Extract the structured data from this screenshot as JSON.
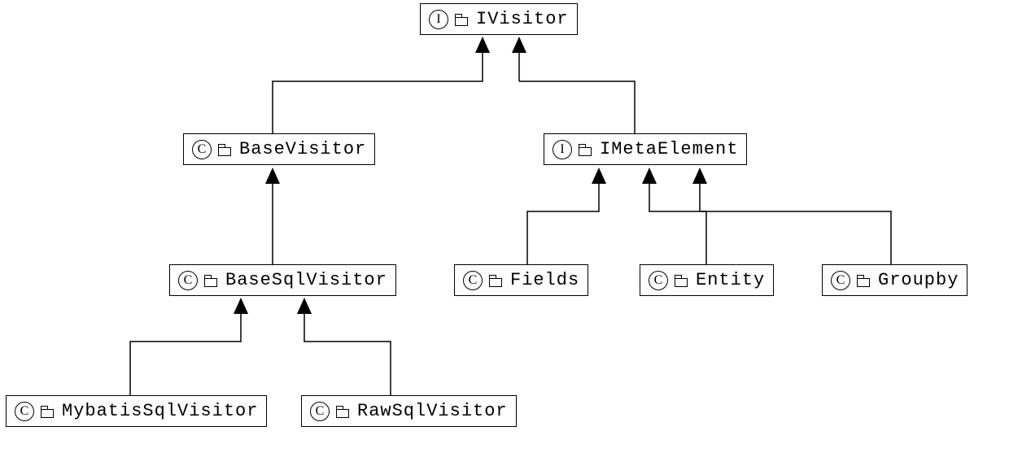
{
  "nodes": {
    "ivisitor": {
      "label": "IVisitor",
      "stereotype": "I"
    },
    "basevisitor": {
      "label": "BaseVisitor",
      "stereotype": "C"
    },
    "imetaelement": {
      "label": "IMetaElement",
      "stereotype": "I"
    },
    "basesqlvisitor": {
      "label": "BaseSqlVisitor",
      "stereotype": "C"
    },
    "fields": {
      "label": "Fields",
      "stereotype": "C"
    },
    "entity": {
      "label": "Entity",
      "stereotype": "C"
    },
    "groupby": {
      "label": "Groupby",
      "stereotype": "C"
    },
    "mybatissqlvisitor": {
      "label": "MybatisSqlVisitor",
      "stereotype": "C"
    },
    "rawsqlvisitor": {
      "label": "RawSqlVisitor",
      "stereotype": "C"
    }
  }
}
